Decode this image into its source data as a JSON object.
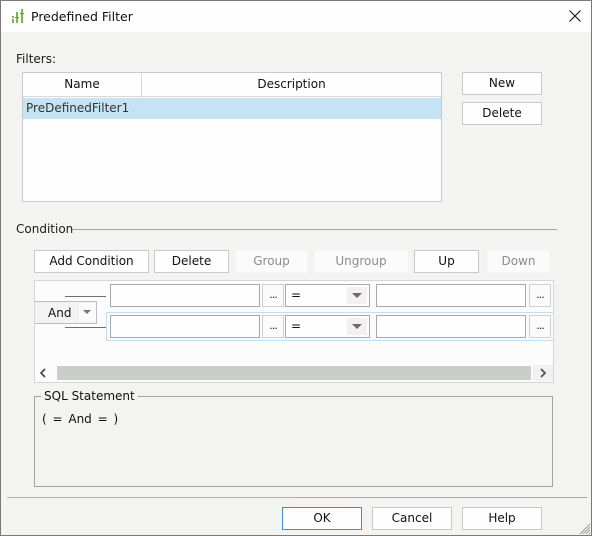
{
  "window": {
    "title": "Predefined Filter",
    "icon": "filter-bars-icon",
    "close_icon": "close-icon"
  },
  "filters": {
    "label": "Filters:",
    "columns": [
      "Name",
      "Description"
    ],
    "rows": [
      {
        "name": "PreDefinedFilter1",
        "description": "",
        "selected": true
      }
    ],
    "new_label": "New",
    "delete_label": "Delete"
  },
  "condition": {
    "label": "Condition",
    "toolbar": {
      "add_condition": "Add Condition",
      "delete": "Delete",
      "group": "Group",
      "ungroup": "Ungroup",
      "up": "Up",
      "down": "Down"
    },
    "toolbar_disabled": [
      "Group",
      "Ungroup",
      "Down"
    ],
    "logic_operator": "And",
    "rows": [
      {
        "left_value": "",
        "ellipsis": "...",
        "operator": "=",
        "right_value": "",
        "right_ellipsis": "..."
      },
      {
        "left_value": "",
        "ellipsis": "...",
        "operator": "=",
        "right_value": "",
        "right_ellipsis": "...",
        "selected": true
      }
    ],
    "scroll_left_icon": "chevron-left-icon",
    "scroll_right_icon": "chevron-right-icon"
  },
  "sql": {
    "label": "SQL Statement",
    "text": "( = And = )"
  },
  "footer": {
    "ok": "OK",
    "cancel": "Cancel",
    "help": "Help"
  },
  "colors": {
    "selection": "#c5e3f5",
    "accent_icon": "#7ab648",
    "default_button_border": "#3d8fd1"
  }
}
